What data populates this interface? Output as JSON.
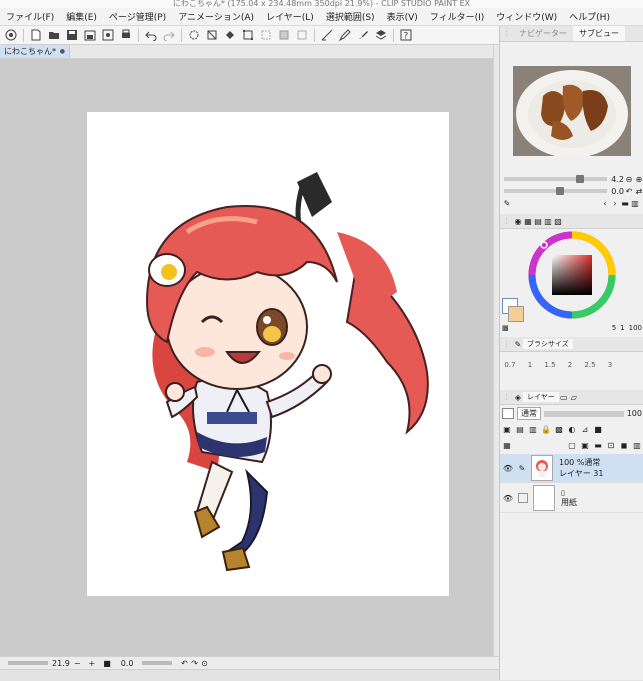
{
  "window": {
    "title": "にわこちゃん* (175.04 x 234.48mm 350dpi 21.9%) - CLIP STUDIO PAINT EX"
  },
  "menu": [
    "ファイル(F)",
    "編集(E)",
    "ページ管理(P)",
    "アニメーション(A)",
    "レイヤー(L)",
    "選択範囲(S)",
    "表示(V)",
    "フィルター(I)",
    "ウィンドウ(W)",
    "ヘルプ(H)"
  ],
  "document_tab": {
    "name": "にわこちゃん*",
    "close": "●"
  },
  "status": {
    "zoom": "21.9",
    "minus": "−",
    "plus": "+",
    "angle": "0.0"
  },
  "navigator": {
    "tabs": [
      "ナビゲーター",
      "サブビュー"
    ],
    "zoom_value": "4.2",
    "angle_value": "0.0"
  },
  "color": {
    "opacity_label": "100",
    "left_number": "5",
    "right_number": "1",
    "percent": "100"
  },
  "brush_size": {
    "tab": "ブラシサイズ",
    "sizes": [
      "0.7",
      "1",
      "1.5",
      "2",
      "2.5",
      "3"
    ]
  },
  "layers": {
    "tabs": [
      "レイヤー",
      "",
      ""
    ],
    "blend_mode": "通常",
    "opacity": "100",
    "items": [
      {
        "info": "100 %通常",
        "name": "レイヤー 31",
        "selected": true
      },
      {
        "info": "",
        "name": "用紙",
        "selected": false
      }
    ]
  },
  "colors": {
    "accent": "#cfe0f2",
    "hair": "#e55a55",
    "canvas_bg": "#cbcbcb"
  }
}
